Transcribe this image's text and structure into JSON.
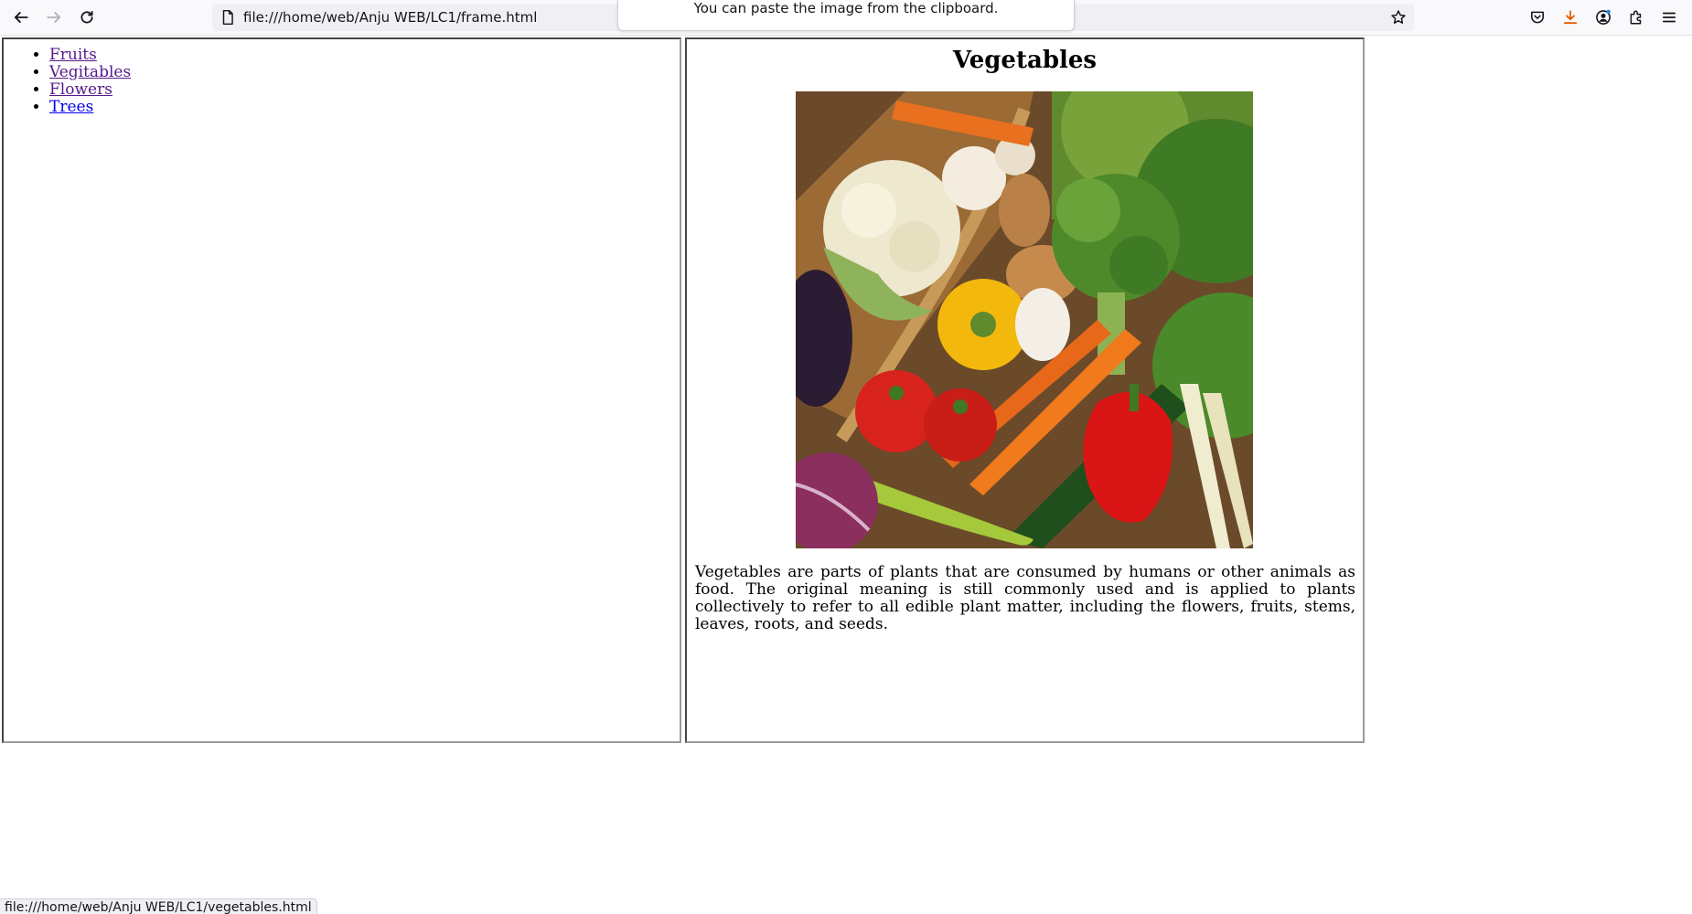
{
  "browser": {
    "url": "file:///home/web/Anju WEB/LC1/frame.html",
    "notification": "You can paste the image from the clipboard.",
    "status_url": "file:///home/web/Anju WEB/LC1/vegetables.html",
    "icons": [
      "back-icon",
      "forward-icon",
      "reload-icon",
      "page-icon",
      "bookmark-star-icon",
      "pocket-icon",
      "download-icon",
      "account-icon",
      "extensions-icon",
      "menu-icon"
    ],
    "download_icon_color": "#e65c00"
  },
  "nav": {
    "items": [
      {
        "label": "Fruits"
      },
      {
        "label": "Vegitables"
      },
      {
        "label": "Flowers"
      },
      {
        "label": "Trees"
      }
    ]
  },
  "content": {
    "title": "Vegetables",
    "description": "Vegetables are parts of plants that are consumed by humans or other animals as food. The original meaning is still commonly used and is applied to plants collectively to refer to all edible plant matter, including the flowers, fruits, stems, leaves, roots, and seeds."
  }
}
